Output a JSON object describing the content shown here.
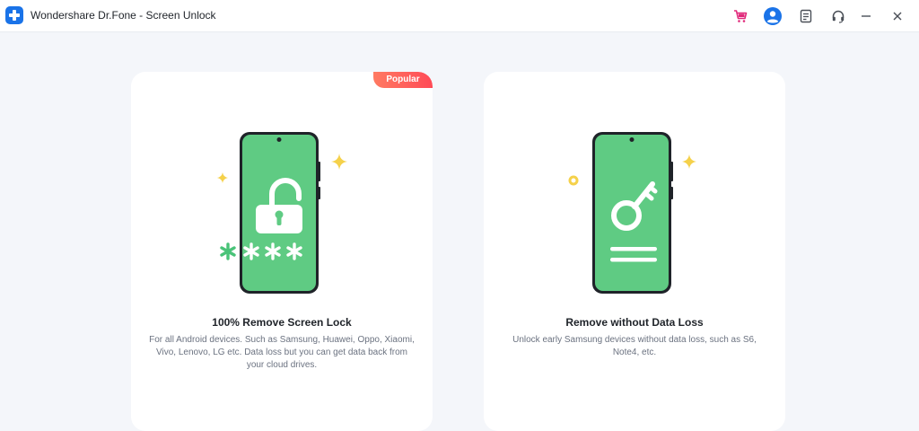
{
  "window": {
    "title": "Wondershare Dr.Fone - Screen Unlock",
    "logo_icon": "drfone-plus-icon",
    "controls": [
      "cart-icon",
      "account-icon",
      "feedback-icon",
      "support-headset-icon",
      "minimize-icon",
      "close-icon"
    ]
  },
  "colors": {
    "accent": "#1a73e8",
    "phone_green": "#5fcb83",
    "star_yellow": "#f5d14a",
    "badge": "#ff5a5a",
    "cart": "#e0287a"
  },
  "cards": [
    {
      "badge": "Popular",
      "title": "100% Remove Screen Lock",
      "description": "For all Android devices. Such as Samsung, Huawei, Oppo, Xiaomi, Vivo, Lenovo, LG etc. Data loss but you can get data back from your cloud drives.",
      "illustration": "phone-unlocked-padlock-icon",
      "pin_mask": "****"
    },
    {
      "title": "Remove without Data Loss",
      "description": "Unlock early Samsung devices without data loss, such as S6, Note4, etc.",
      "illustration": "phone-key-icon"
    }
  ]
}
